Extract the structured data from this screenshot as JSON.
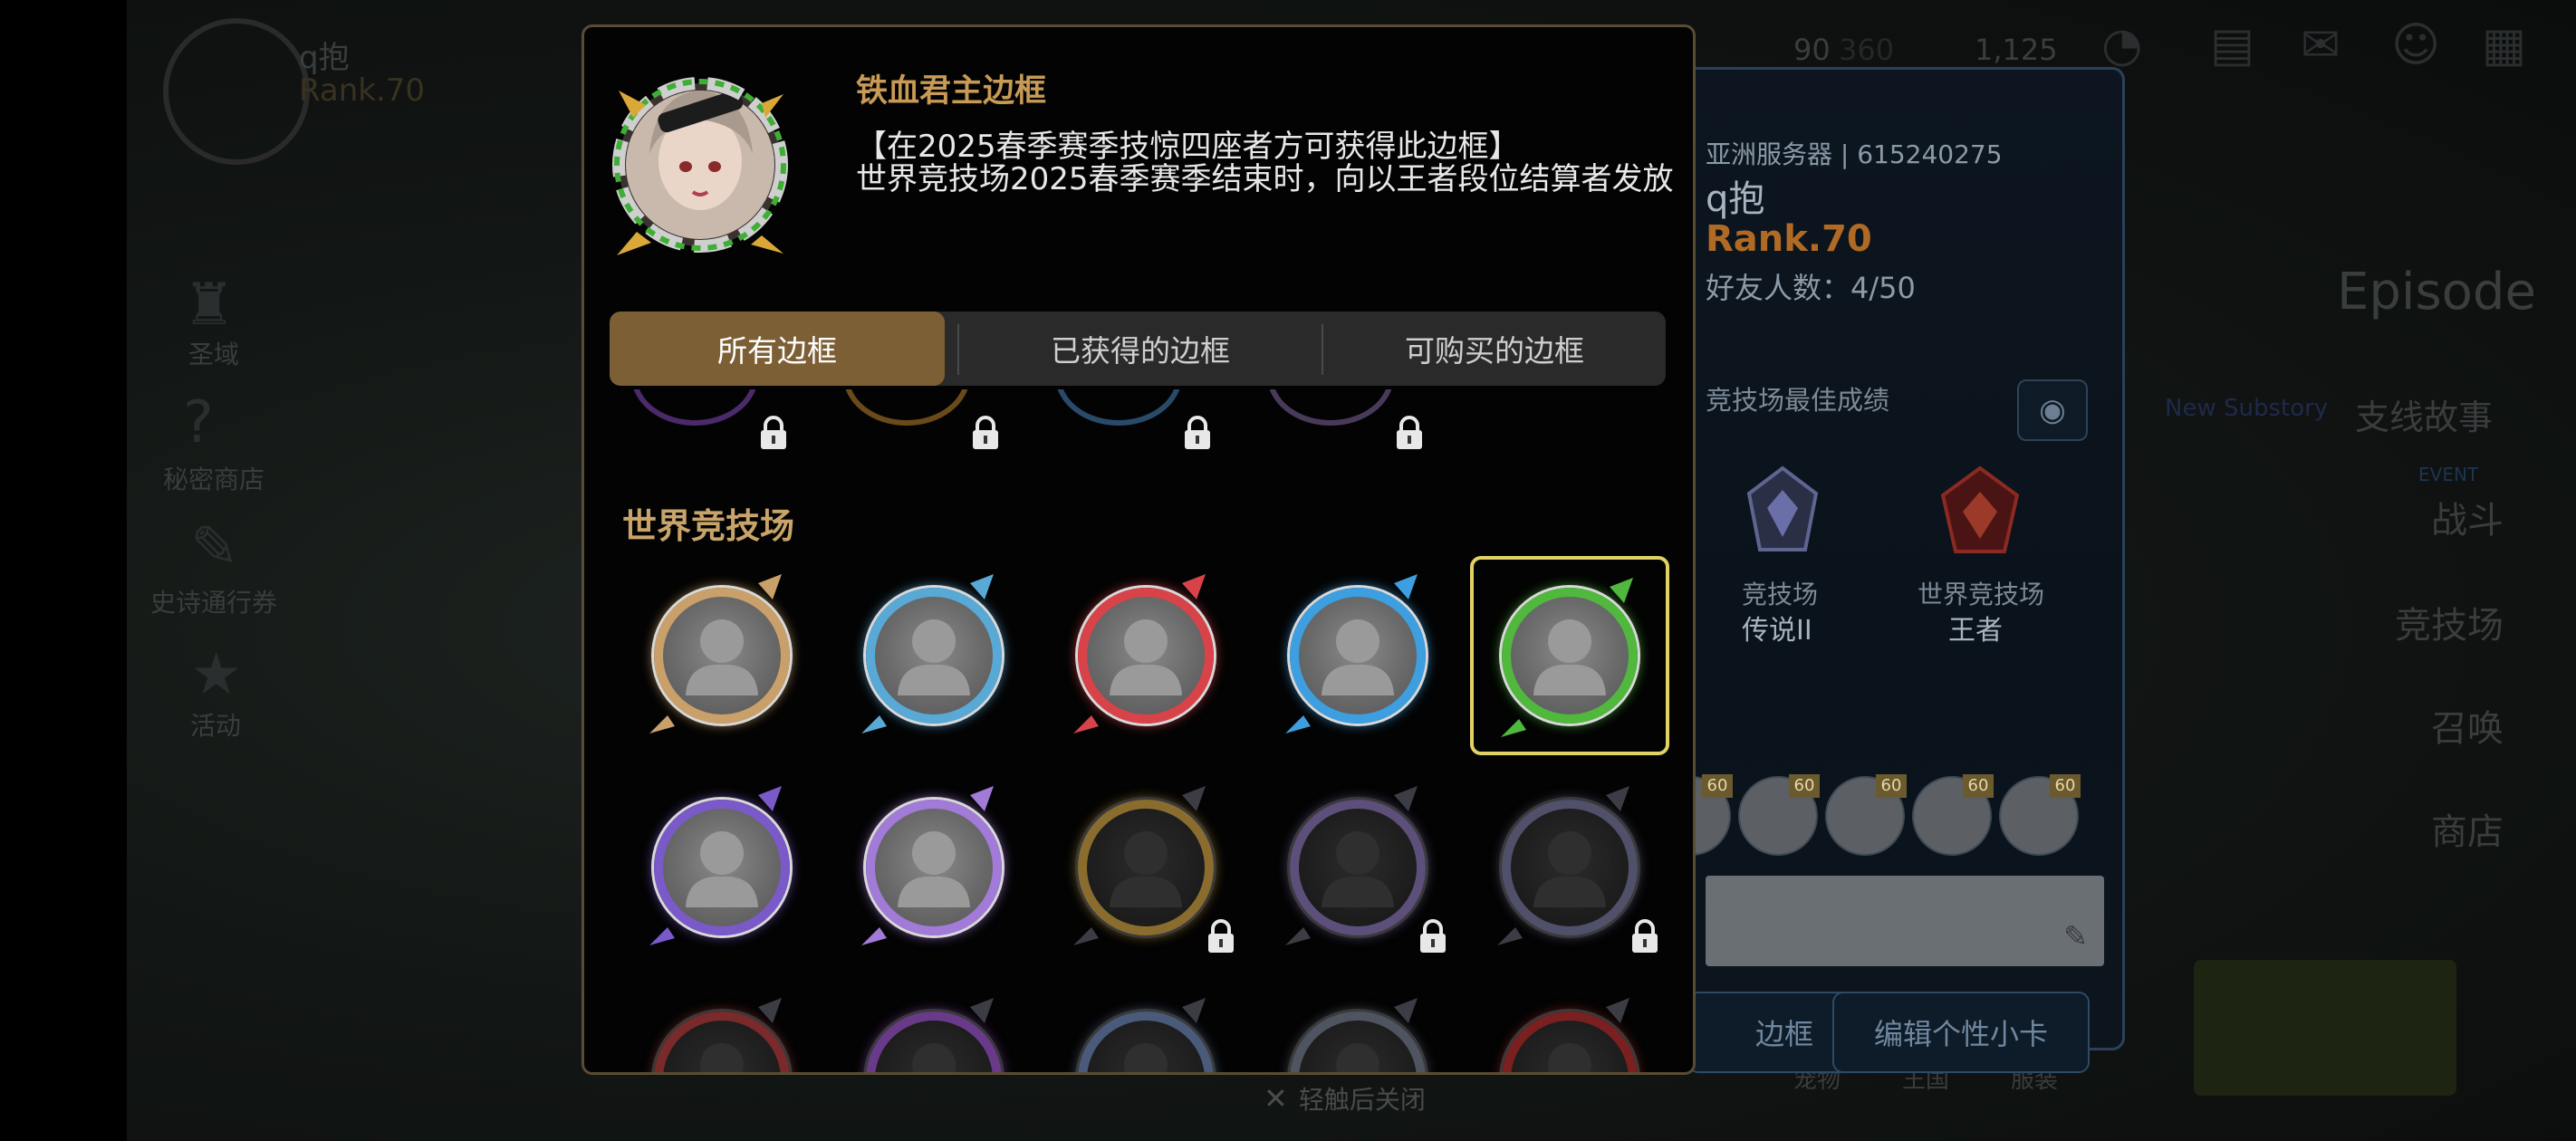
{
  "background": {
    "player_name": "q抱",
    "player_rank": "Rank.70",
    "sidebar_items": [
      "圣域",
      "秘密商店",
      "史诗通行券",
      "活动"
    ],
    "top_currency_1": "90",
    "top_currency_1_max": "360",
    "top_currency_2": "1,125",
    "right_menu": {
      "episode": "Episode",
      "substory_badge": "New Substory",
      "substory": "支线故事",
      "battle_badge": "EVENT",
      "battle": "战斗",
      "arena": "竞技场",
      "summon": "召唤",
      "shop": "商店"
    },
    "profile_card": {
      "server": "亚洲服务器 | 615240275",
      "name": "q抱",
      "rank": "Rank.70",
      "friends": "好友人数：4/50",
      "arena_best": "竞技场最佳成绩",
      "arena_label": "竞技场",
      "arena_tier": "传说II",
      "world_arena_label": "世界竞技场",
      "world_arena_tier": "王者",
      "hero_level": "60",
      "btn_frame": "边框",
      "btn_edit_card": "编辑个性小卡"
    },
    "bottom_items": [
      "宠物",
      "王国",
      "服装"
    ]
  },
  "modal": {
    "frame_name": "铁血君主边框",
    "frame_condition": "【在2025春季赛季技惊四座者方可获得此边框】",
    "frame_description": "世界竞技场2025春季赛季结束时，向以王者段位结算者发放",
    "tabs": [
      {
        "label": "所有边框",
        "active": true
      },
      {
        "label": "已获得的边框",
        "active": false
      },
      {
        "label": "可购买的边框",
        "active": false
      }
    ],
    "section_title": "世界竞技场",
    "frames": [
      {
        "name": "silver-gold-frame",
        "owned": true,
        "color": "#c9a06a"
      },
      {
        "name": "blue-gold-frame",
        "owned": true,
        "color": "#58a9d6"
      },
      {
        "name": "red-frame",
        "owned": true,
        "color": "#d8434a"
      },
      {
        "name": "blue-crystal-frame",
        "owned": true,
        "color": "#3d9ee0"
      },
      {
        "name": "iron-blood-monarch-frame",
        "owned": true,
        "selected": true,
        "color": "#4fb83d"
      },
      {
        "name": "purple-frame",
        "owned": true,
        "color": "#7a59c8"
      },
      {
        "name": "purple-gold-frame",
        "owned": true,
        "color": "#a27ad8"
      },
      {
        "name": "dark-gold-frame",
        "owned": false,
        "color": "#8a6d2e"
      },
      {
        "name": "dark-violet-frame",
        "owned": false,
        "color": "#5c4f7a"
      },
      {
        "name": "dark-silver-frame",
        "owned": false,
        "color": "#50506a"
      },
      {
        "name": "dark-red-frame",
        "owned": false,
        "color": "#7a2a2a"
      },
      {
        "name": "dark-purple-frame",
        "owned": false,
        "color": "#6a3a8a"
      },
      {
        "name": "dark-blue-frame",
        "owned": false,
        "color": "#4a5a7a"
      },
      {
        "name": "dark-steel-frame",
        "owned": false,
        "color": "#4e5560"
      },
      {
        "name": "dark-crimson-frame",
        "owned": false,
        "color": "#7a2020"
      }
    ]
  },
  "close_hint": "轻触后关闭"
}
